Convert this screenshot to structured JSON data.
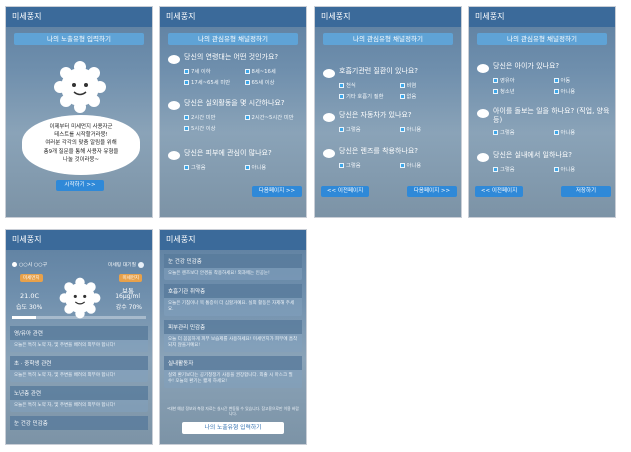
{
  "app_title": "미세풍지",
  "s1": {
    "ribbon": "나의 노출유형 입력하기",
    "message": [
      "이제부터 미세먼지 사용자군",
      "테스트를 시작할거라뭉!",
      "여러분 각각의 맞춤 알림을 위해",
      "총9개 질문을 통해 사용자 유형을",
      "나눌 것이라뭉~"
    ],
    "start_button": "시작하기 >>"
  },
  "s2": {
    "ribbon": "나의 관심유형 채널정하기",
    "q1": "당신의 연령대는 어떤 것인가요?",
    "q1_opts": [
      "7세 이하",
      "8세~16세",
      "17세~65세 미만",
      "65세 이상"
    ],
    "q2": "당신은 실외활동을 몇 시간하나요?",
    "q2_opts": [
      "2시간 미만",
      "2시간~5시간 미만",
      "5시간 이상"
    ],
    "q3": "당신은 피부에 관심이 많나요?",
    "q3_opts": [
      "그렇음",
      "아니용"
    ],
    "next_button": "다음페이지 >>"
  },
  "s3": {
    "ribbon": "나의 관심유형 채널정하기",
    "q1": "호흡기관련 질환이 있나요?",
    "q1_opts": [
      "천식",
      "비염",
      "기타 호흡기 질환",
      "없음"
    ],
    "q2": "당신은 자동차가 있나요?",
    "q2_opts": [
      "그렇음",
      "아니용"
    ],
    "q3": "당신은 렌즈를 착용하나요?",
    "q3_opts": [
      "그렇음",
      "아니용"
    ],
    "prev_button": "<< 이전페이지",
    "next_button": "다음페이지 >>"
  },
  "s4": {
    "ribbon": "나의 관심유형 채널정하기",
    "q1": "당신은 아이가 있나요?",
    "q1_opts": [
      "영유아",
      "아동",
      "청소년",
      "아니용"
    ],
    "q2": "아이를 돌보는 일을 하나요? (직업, 양육 등)",
    "q2_opts": [
      "그렇음",
      "아니용"
    ],
    "q3": "당신은 실내에서 일하나요?",
    "q3_opts": [
      "그렇음",
      "아니용"
    ],
    "prev_button": "<< 이전페이지",
    "save_button": "저장하기"
  },
  "s5": {
    "location": "○○시 ○○구",
    "status_tag": "미세팅 대기질",
    "temp": "21.0C",
    "humidity": "습도 30%",
    "pm_label": "보통",
    "pm_value": "16μg/ml",
    "rain": "강수 70%",
    "left_badge": "미세먼지",
    "right_badge": "미세먼지",
    "sections": [
      {
        "title": "영/유아 관련",
        "body": "오늘은 특히 노약 자, 및 주변을 배려의 외부야 합니다!"
      },
      {
        "title": "초 · 중학생 관련",
        "body": "오늘은 특히 노약 자, 및 주변을 배려의 외부야 합니다!"
      },
      {
        "title": "노년층 관련",
        "body": "오늘은 특히 노약 자, 및 주변을 배려의 외부야 합니다!"
      },
      {
        "title": "눈 건강 민감층",
        "body": ""
      }
    ]
  },
  "s6": {
    "cards": [
      {
        "title": "눈 건강 민감층",
        "body": "오늘은 렌즈보다 안경을 착용하세요! 외과에는 인공눈!"
      },
      {
        "title": "호흡기관 취약층",
        "body": "오늘은 기침이나 목 통증이 더 심할거예요. 실외 활동은 자제해 주세요."
      },
      {
        "title": "피부관리 민감층",
        "body": "오늘 더 꼼꼼하게 피부 보습제를 사용하세요! 미세먼지가 피부에 흡착되지 않을거예요!"
      },
      {
        "title": "실내활동자",
        "body": "실외 환기보다는 공기청정기 사용을 권장합니다. 외출 시 마스크 필수! 오늘의 환기는 짧게 하세요!"
      }
    ],
    "footnote": "*대한 예상 정보와 측정 자료는 실시간 변동될 수 있습니다. 참고용으로만 이용 바랍니다.",
    "input_button": "나의 노출유형 입력하기"
  }
}
